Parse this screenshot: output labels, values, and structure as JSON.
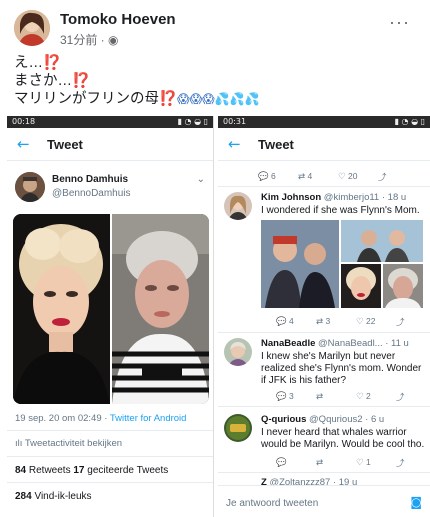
{
  "post": {
    "author": "Tomoko Hoeven",
    "time": "31分前 · ",
    "more": "···",
    "line1": "え…",
    "line1_mark": "⁉️",
    "line2": "まさか…",
    "line2_mark": "⁉️",
    "line3": "マリリンがフリンの母",
    "line3_mark": "⁉️",
    "emoji_faces": "😱😱😱",
    "emoji_drops": "💦💦💦"
  },
  "left_screen": {
    "status_time": "00:18",
    "status_right": "▮ ◔ ◒ ▯",
    "header_title": "Tweet",
    "author_name": "Benno Damhuis",
    "author_handle": "@BennoDamhuis",
    "timestamp": "19 sep. 20 om 02:49 · ",
    "source": "Twitter for Android",
    "activity": "ılı Tweetactiviteit bekijken",
    "retweets_count": "84",
    "retweets_label": " Retweets   ",
    "quotes_count": "17",
    "quotes_label": " geciteerde Tweets",
    "likes_count": "284",
    "likes_label": " Vind-ik-leuks"
  },
  "right_screen": {
    "status_time": "00:31",
    "status_right": "▮ ◔ ◒ ▯",
    "header_title": "Tweet",
    "top_actions": [
      "💬 6",
      "⇄ 4",
      "♡ 20",
      "⤴"
    ],
    "replies": [
      {
        "name": "Kim Johnson",
        "meta": " @kimberjo11 · 18 u",
        "text": "I wondered if she was Flynn's Mom.",
        "actions": [
          "💬 4",
          "⇄ 3",
          "♡ 22",
          "⤴"
        ]
      },
      {
        "name": "NanaBeadle",
        "meta": " @NanaBeadl... · 11 u",
        "text": "I knew she's Marilyn but never realized she's Flynn's mom.   Wonder if JFK is his father?",
        "actions": [
          "💬 3",
          "⇄",
          "♡ 2",
          "⤴"
        ]
      },
      {
        "name": "Q-qurious",
        "meta": " @Qqurious2 · 6 u",
        "text": "I never heard that whales warrior would be Marilyn. Would be cool tho.",
        "actions": [
          "💬",
          "⇄",
          "♡ 1",
          "⤴"
        ]
      },
      {
        "name": "Z",
        "meta": " @Zoltanzzz87 · 19 u",
        "text": "",
        "actions": []
      }
    ],
    "reply_placeholder": "Je antwoord tweeten"
  }
}
